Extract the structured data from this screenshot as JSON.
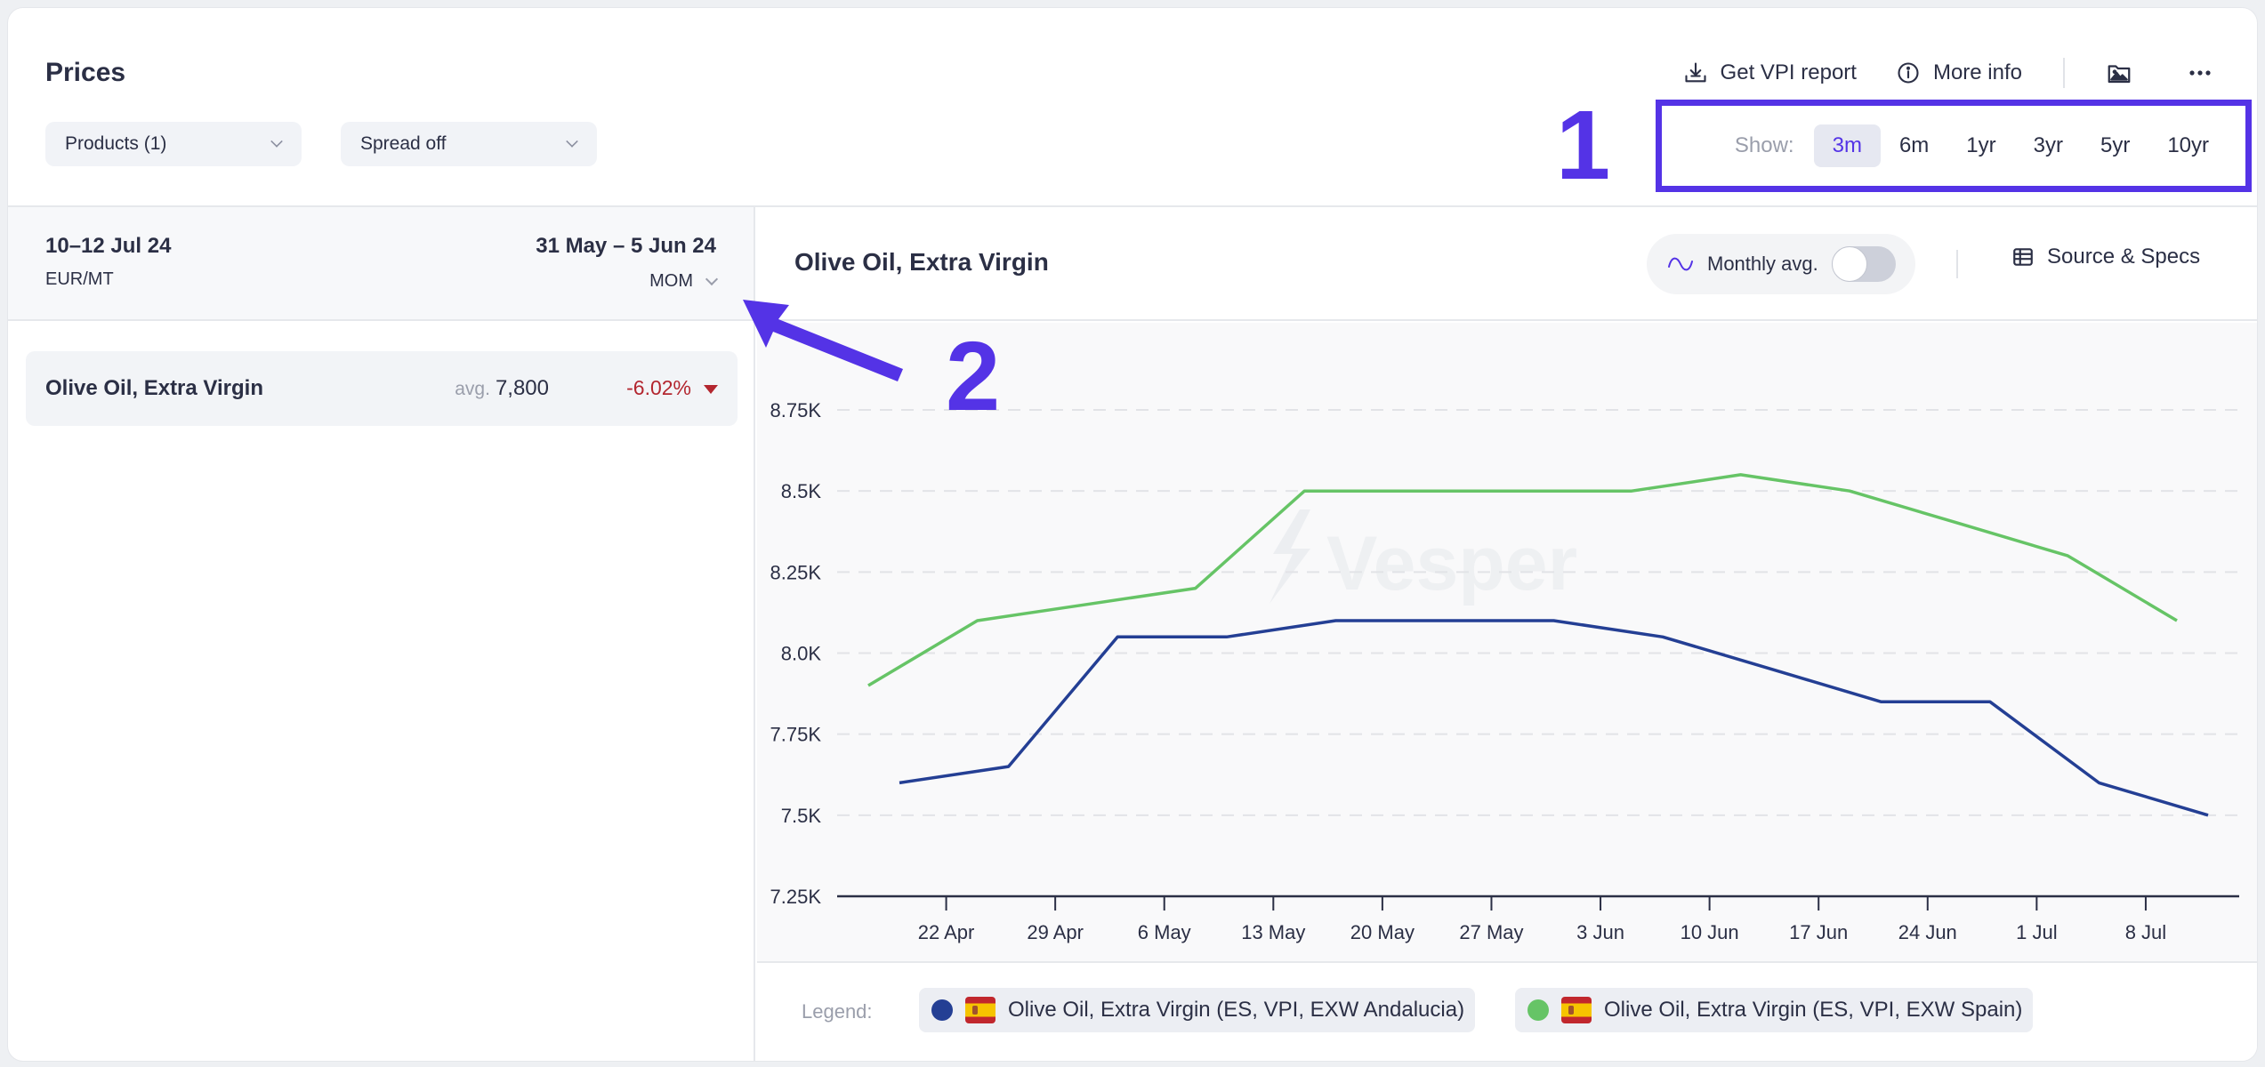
{
  "header": {
    "title": "Prices",
    "products_dropdown": "Products (1)",
    "spread_dropdown": "Spread off",
    "actions": {
      "vpi_report": "Get VPI report",
      "more_info": "More info"
    },
    "show_label": "Show:",
    "ranges": [
      "3m",
      "6m",
      "1yr",
      "3yr",
      "5yr",
      "10yr"
    ],
    "active_range": "3m"
  },
  "annotations": {
    "one": "1",
    "two": "2",
    "color": "#5433e6"
  },
  "left_panel": {
    "current_period": "10–12 Jul 24",
    "unit": "EUR/MT",
    "compare_period": "31 May – 5 Jun 24",
    "compare_mode": "MOM",
    "rows": [
      {
        "name": "Olive Oil, Extra Virgin",
        "avg_label": "avg.",
        "avg_value": "7,800",
        "change": "-6.02%",
        "direction": "down"
      }
    ]
  },
  "chart_panel": {
    "title": "Olive Oil, Extra Virgin",
    "monthly_avg_label": "Monthly avg.",
    "monthly_avg_enabled": false,
    "source_specs": "Source & Specs",
    "watermark": "Vesper",
    "legend_label": "Legend:"
  },
  "chart_data": {
    "type": "line",
    "title": "Olive Oil, Extra Virgin",
    "xlabel": "",
    "ylabel": "",
    "ylim": [
      7250,
      8750
    ],
    "yticks": [
      7250,
      7500,
      7750,
      8000,
      8250,
      8500,
      8750
    ],
    "ytick_labels": [
      "7.25K",
      "7.5K",
      "7.75K",
      "8.0K",
      "8.25K",
      "8.5K",
      "8.75K"
    ],
    "xlim": [
      "2024-04-15",
      "2024-07-14"
    ],
    "xticks": [
      "2024-04-22",
      "2024-04-29",
      "2024-05-06",
      "2024-05-13",
      "2024-05-20",
      "2024-05-27",
      "2024-06-03",
      "2024-06-10",
      "2024-06-17",
      "2024-06-24",
      "2024-07-01",
      "2024-07-08"
    ],
    "xtick_labels": [
      "22 Apr",
      "29 Apr",
      "6 May",
      "13 May",
      "20 May",
      "27 May",
      "3 Jun",
      "10 Jun",
      "17 Jun",
      "24 Jun",
      "1 Jul",
      "8 Jul"
    ],
    "grid": true,
    "legend": "bottom",
    "series": [
      {
        "name": "Olive Oil, Extra Virgin (ES, VPI, EXW Andalucia)",
        "color": "#243f94",
        "x": [
          "2024-04-19",
          "2024-04-26",
          "2024-05-03",
          "2024-05-10",
          "2024-05-17",
          "2024-05-24",
          "2024-05-31",
          "2024-06-07",
          "2024-06-14",
          "2024-06-21",
          "2024-06-28",
          "2024-07-05",
          "2024-07-12"
        ],
        "values": [
          7600,
          7650,
          8050,
          8050,
          8100,
          8100,
          8100,
          8050,
          7950,
          7850,
          7850,
          7600,
          7500
        ]
      },
      {
        "name": "Olive Oil, Extra Virgin (ES, VPI, EXW Spain)",
        "color": "#66c466",
        "x": [
          "2024-04-17",
          "2024-04-24",
          "2024-05-01",
          "2024-05-08",
          "2024-05-15",
          "2024-05-22",
          "2024-05-29",
          "2024-06-05",
          "2024-06-12",
          "2024-06-19",
          "2024-06-26",
          "2024-07-03",
          "2024-07-10"
        ],
        "values": [
          7900,
          8100,
          8150,
          8200,
          8500,
          8500,
          8500,
          8500,
          8550,
          8500,
          8400,
          8300,
          8100
        ]
      }
    ]
  }
}
